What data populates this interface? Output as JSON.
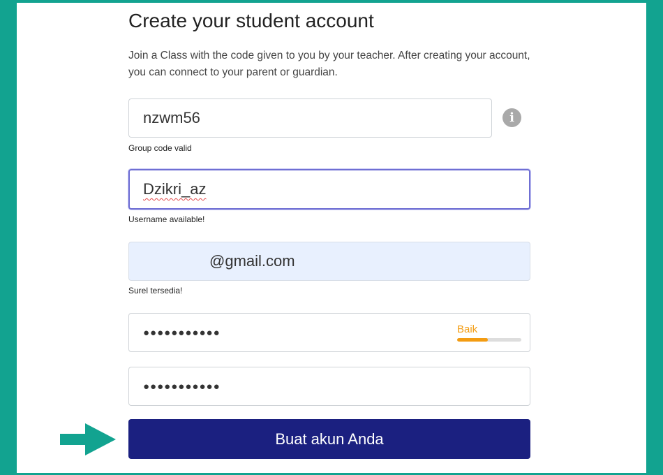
{
  "page": {
    "title": "Create your student account",
    "intro": "Join a Class with the code given to you by your teacher. After creating your account, you can connect to your parent or guardian."
  },
  "form": {
    "group_code": {
      "value": "nzwm56",
      "hint": "Group code valid"
    },
    "info_icon": "info-icon",
    "username": {
      "value": "Dzikri_az",
      "hint": "Username available!"
    },
    "email": {
      "value": "@gmail.com",
      "hint": "Surel tersedia!"
    },
    "password": {
      "masked": "●●●●●●●●●●●",
      "strength_label": "Baik",
      "strength_fraction": 0.48,
      "strength_color": "#f39c12"
    },
    "confirm_password": {
      "masked": "●●●●●●●●●●●"
    },
    "submit_label": "Buat akun Anda"
  },
  "annotation": {
    "arrow_icon": "right-arrow-icon",
    "arrow_color": "#12a390"
  },
  "colors": {
    "frame": "#12a390",
    "button": "#1b2080",
    "focus_border": "#6f6fd3",
    "autofill_bg": "#e8f0fe"
  }
}
